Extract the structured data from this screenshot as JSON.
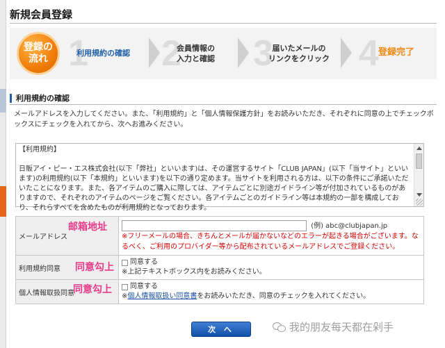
{
  "page": {
    "title": "新規会員登録"
  },
  "flow": {
    "badge": "登録の\n流れ",
    "steps": [
      {
        "num": "1",
        "label": "利用規約の確認",
        "state": "active"
      },
      {
        "num": "2",
        "label": "会員情報の\n入力と確認",
        "state": "inactive"
      },
      {
        "num": "3",
        "label": "届いたメールの\nリンクをクリック",
        "state": "inactive"
      },
      {
        "num": "4",
        "label": "登録完了",
        "state": "done"
      }
    ]
  },
  "section": {
    "heading": "利用規約の確認",
    "intro": "メールアドレスを入力してください。また、「利用規約」と「個人情報保護方針」をお読みいただき、それぞれに同意の上でチェックボックスにチェックを入れてから、次へお進みください。"
  },
  "terms": {
    "text": "【利用規約】\n\n日販アイ・ピー・エス株式会社(以下「弊社」といいます)は、その運営するサイト「CLUB JAPAN」(以下「当サイト」といいます)の利用規約(以下「本規約」といいます)を以下の通り定めます。当サイトを利用される方は、以下の条件にご承諾いただいたことになります。また、各アイテムのご購入に際しては、アイテムごとに別途ガイドライン等が付加されているものがありますので、それぞれのアイテムのページをご覧ください。各アイテムごとのガイドライン等は本規約の一部を構成しており、それらすべてを含めたものが利用規約となっております。"
  },
  "form": {
    "email": {
      "label": "メールアドレス",
      "value": "",
      "example": "(例) abc@clubjapan.jp",
      "warning": "※フリーメールの場合、きちんとメールが届かないなどのエラーが起きる場合がございます。なるべく、ご利用のプロバイダー等から配布されているメールアドレスでご登録ください。"
    },
    "terms_agree": {
      "label": "利用規約同意",
      "checkbox_label": "同意する",
      "note": "※上記テキストボックス内をお読みください。"
    },
    "privacy_agree": {
      "label": "個人情報取扱同意",
      "checkbox_label": "同意する",
      "note_prefix": "※",
      "link_text": "個人情報取扱い同意書",
      "note_suffix": "をお読みいただき、同意のチェックを入れてください。"
    }
  },
  "overlays": {
    "email": "邮箱地址",
    "terms": "同意勾上",
    "privacy": "同意勾上"
  },
  "buttons": {
    "next": "次 へ"
  },
  "watermark": {
    "text": "我的朋友每天都在剁手"
  },
  "colors": {
    "accent_orange": "#f07d08",
    "link_blue": "#1a4fa0",
    "warning_red": "#d40000",
    "overlay_pink": "#ea3b8a"
  }
}
